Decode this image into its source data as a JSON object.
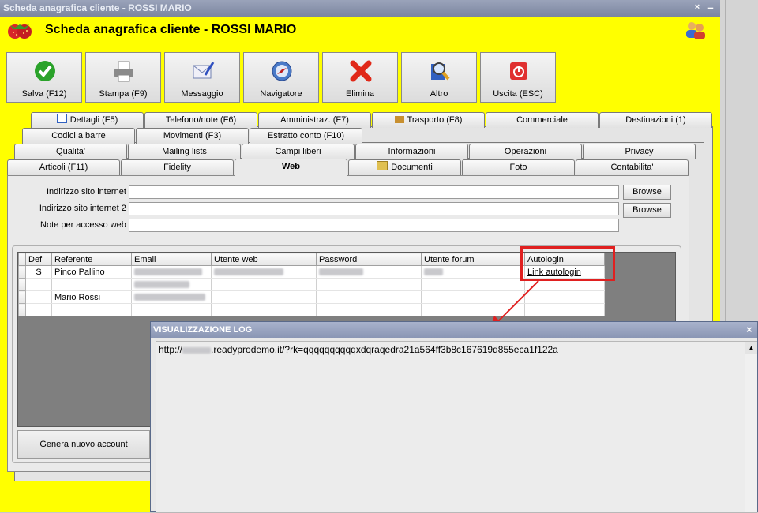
{
  "window": {
    "title": "Scheda anagrafica cliente - ROSSI MARIO",
    "header_title": "Scheda anagrafica cliente - ROSSI MARIO",
    "minimize_glyph": "–",
    "close_glyph": "×",
    "bg_color": "#ffff00"
  },
  "toolbar": [
    {
      "label": "Salva (F12)",
      "icon": "check-icon"
    },
    {
      "label": "Stampa (F9)",
      "icon": "printer-icon"
    },
    {
      "label": "Messaggio",
      "icon": "envelope-icon"
    },
    {
      "label": "Navigatore",
      "icon": "compass-icon"
    },
    {
      "label": "Elimina",
      "icon": "delete-x-icon"
    },
    {
      "label": "Altro",
      "icon": "magnifier-book-icon"
    },
    {
      "label": "Uscita (ESC)",
      "icon": "power-icon"
    }
  ],
  "tabs": {
    "row1": [
      "Dettagli (F5)",
      "Telefono/note (F6)",
      "Amministraz. (F7)",
      "Trasporto (F8)",
      "Commerciale",
      "Destinazioni (1)"
    ],
    "row2": [
      "Codici a barre",
      "Movimenti (F3)",
      "Estratto conto (F10)"
    ],
    "row3": [
      "Qualita'",
      "Mailing lists",
      "Campi liberi",
      "Informazioni",
      "Operazioni",
      "Privacy"
    ],
    "row4": [
      "Articoli (F11)",
      "Fidelity",
      "Web",
      "Documenti",
      "Foto",
      "Contabilita'"
    ],
    "active": "Web"
  },
  "web": {
    "label_site": "Indirizzo sito internet :",
    "label_site2": "Indirizzo sito internet 2 :",
    "label_notes": "Note per accesso web :",
    "value_site": "",
    "value_site2": "",
    "value_notes": "",
    "browse_label": "Browse",
    "browse_label2": "Browse"
  },
  "grid": {
    "columns": [
      "Def",
      "Referente",
      "Email",
      "Utente web",
      "Password",
      "Utente forum",
      "Autologin"
    ],
    "rows": [
      {
        "def": "S",
        "referente": "Pinco Pallino",
        "autologin": "Link autologin"
      },
      {
        "def": "",
        "referente": "",
        "autologin": ""
      },
      {
        "def": "",
        "referente": "Mario Rossi",
        "autologin": ""
      },
      {
        "def": "",
        "referente": "",
        "autologin": ""
      }
    ],
    "highlight_color": "#e02020"
  },
  "genera_label": "Genera nuovo account",
  "log": {
    "title": "VISUALIZZAZIONE LOG",
    "close_glyph": "×",
    "url_prefix": "http://",
    "url_rest": ".readyprodemo.it/?rk=qqqqqqqqqqxdqraqedra21a564ff3b8c167619d855eca1f122a",
    "scroll_up_glyph": "▲"
  }
}
